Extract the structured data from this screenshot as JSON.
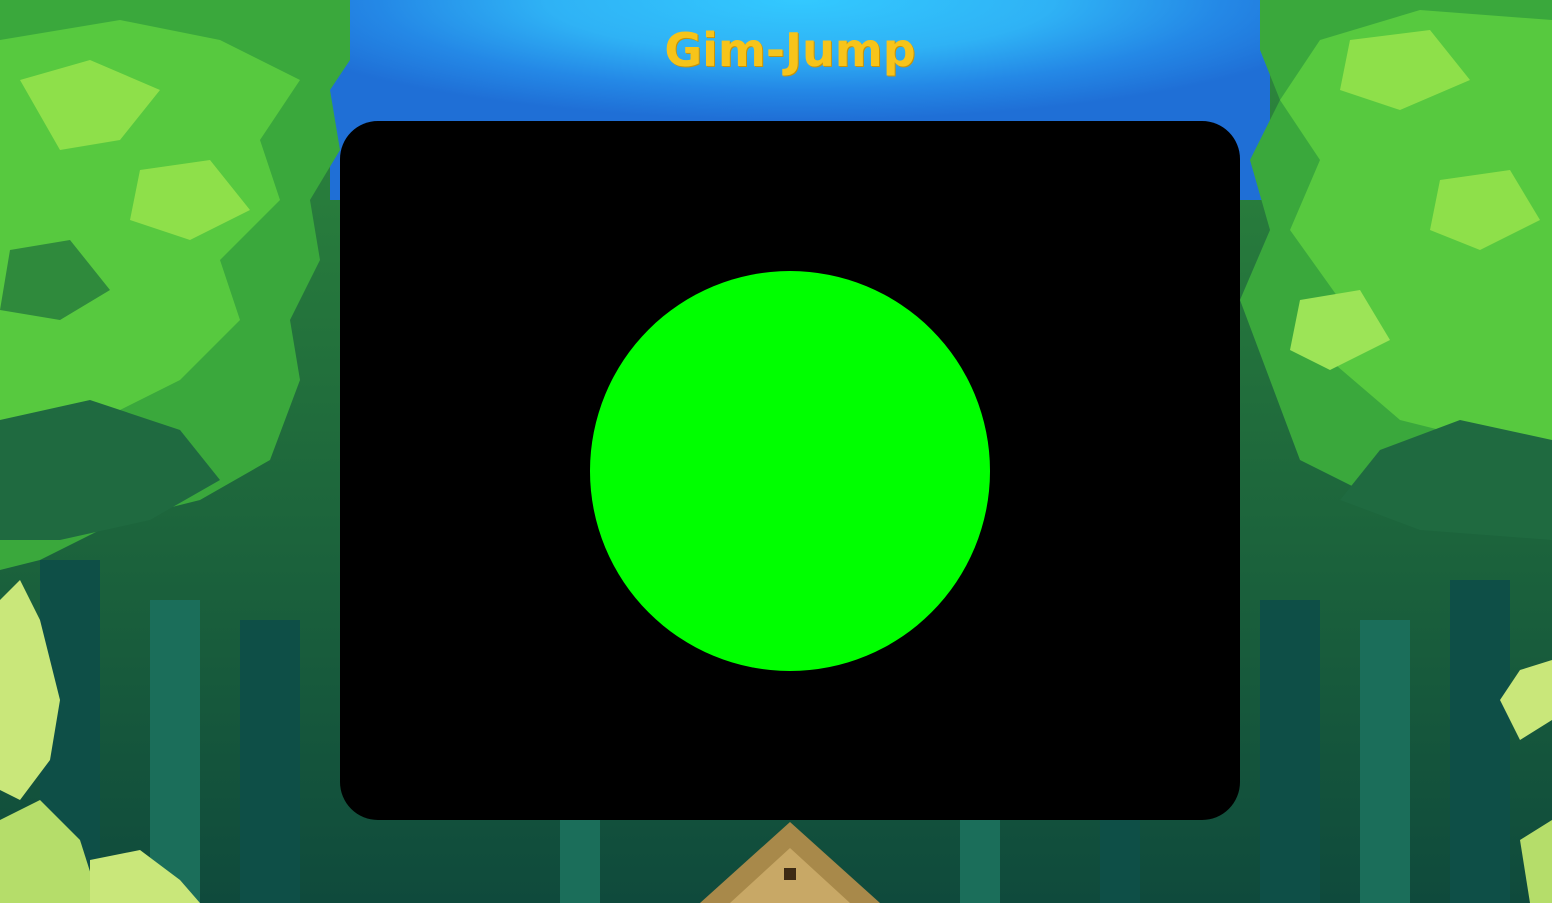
{
  "game": {
    "title": "Gim-Jump"
  },
  "colors": {
    "title": "#f7c41a",
    "canvas": "#000000",
    "player": "#00ff00"
  },
  "icons": {
    "player": "green-circle"
  }
}
